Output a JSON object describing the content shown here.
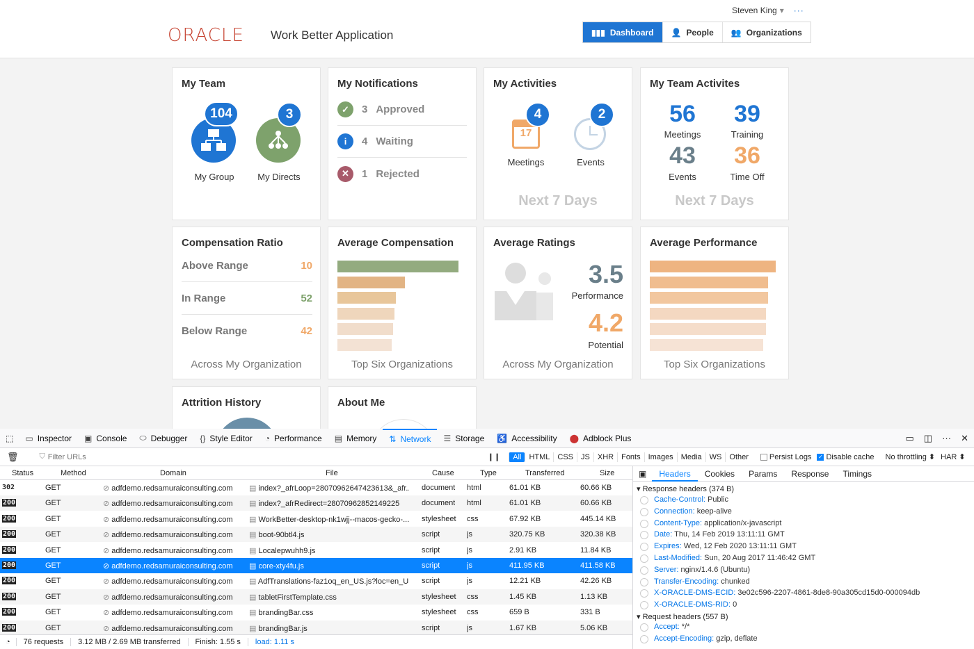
{
  "header": {
    "logo": "ORACLE",
    "app_title": "Work Better Application",
    "user": "Steven King",
    "nav": [
      "Dashboard",
      "People",
      "Organizations"
    ]
  },
  "my_team": {
    "title": "My Team",
    "group_count": "104",
    "group_label": "My Group",
    "directs_count": "3",
    "directs_label": "My Directs"
  },
  "notifications": {
    "title": "My Notifications",
    "items": [
      {
        "count": "3",
        "label": "Approved"
      },
      {
        "count": "4",
        "label": "Waiting"
      },
      {
        "count": "1",
        "label": "Rejected"
      }
    ]
  },
  "activities": {
    "title": "My Activities",
    "meetings_count": "4",
    "meetings_label": "Meetings",
    "calendar_day": "17",
    "events_count": "2",
    "events_label": "Events",
    "footer": "Next 7 Days"
  },
  "team_activities": {
    "title": "My Team Activites",
    "meetings": "56",
    "meetings_label": "Meetings",
    "training": "39",
    "training_label": "Training",
    "events": "43",
    "events_label": "Events",
    "timeoff": "36",
    "timeoff_label": "Time Off",
    "footer": "Next 7 Days"
  },
  "comp_ratio": {
    "title": "Compensation Ratio",
    "rows": [
      {
        "k": "Above Range",
        "v": "10"
      },
      {
        "k": "In Range",
        "v": "52"
      },
      {
        "k": "Below Range",
        "v": "42"
      }
    ],
    "footer": "Across My Organization"
  },
  "avg_comp": {
    "title": "Average Compensation",
    "footer": "Top Six Organizations",
    "bars": [
      1.0,
      0.56,
      0.48,
      0.47,
      0.46,
      0.45
    ]
  },
  "avg_ratings": {
    "title": "Average Ratings",
    "performance": "3.5",
    "performance_label": "Performance",
    "potential": "4.2",
    "potential_label": "Potential",
    "footer": "Across My Organization"
  },
  "avg_perf": {
    "title": "Average Performance",
    "footer": "Top Six Organizations",
    "bars": [
      1.0,
      0.94,
      0.94,
      0.92,
      0.92,
      0.9
    ]
  },
  "attrition": {
    "title": "Attrition History"
  },
  "about": {
    "title": "About Me"
  },
  "devtools": {
    "tabs": [
      "Inspector",
      "Console",
      "Debugger",
      "Style Editor",
      "Performance",
      "Memory",
      "Network",
      "Storage",
      "Accessibility",
      "Adblock Plus"
    ],
    "filter_placeholder": "Filter URLs",
    "types": [
      "All",
      "HTML",
      "CSS",
      "JS",
      "XHR",
      "Fonts",
      "Images",
      "Media",
      "WS",
      "Other"
    ],
    "persist_logs": "Persist Logs",
    "disable_cache": "Disable cache",
    "throttling": "No throttling ⬍",
    "har": "HAR ⬍",
    "columns": [
      "Status",
      "Method",
      "Domain",
      "File",
      "Cause",
      "Type",
      "Transferred",
      "Size"
    ],
    "rows": [
      {
        "status": "302",
        "method": "GET",
        "domain": "adfdemo.redsamuraiconsulting.com",
        "file": "index?_afrLoop=28070962647423613&_afr...",
        "cause": "document",
        "type": "html",
        "transferred": "61.01 KB",
        "size": "60.66 KB"
      },
      {
        "status": "200",
        "method": "GET",
        "domain": "adfdemo.redsamuraiconsulting.com",
        "file": "index?_afrRedirect=28070962852149225",
        "cause": "document",
        "type": "html",
        "transferred": "61.01 KB",
        "size": "60.66 KB"
      },
      {
        "status": "200",
        "method": "GET",
        "domain": "adfdemo.redsamuraiconsulting.com",
        "file": "WorkBetter-desktop-nk1wjj--macos-gecko-...",
        "cause": "stylesheet",
        "type": "css",
        "transferred": "67.92 KB",
        "size": "445.14 KB"
      },
      {
        "status": "200",
        "method": "GET",
        "domain": "adfdemo.redsamuraiconsulting.com",
        "file": "boot-90btl4.js",
        "cause": "script",
        "type": "js",
        "transferred": "320.75 KB",
        "size": "320.38 KB"
      },
      {
        "status": "200",
        "method": "GET",
        "domain": "adfdemo.redsamuraiconsulting.com",
        "file": "Localepwuhh9.js",
        "cause": "script",
        "type": "js",
        "transferred": "2.91 KB",
        "size": "11.84 KB"
      },
      {
        "status": "200",
        "method": "GET",
        "domain": "adfdemo.redsamuraiconsulting.com",
        "file": "core-xty4fu.js",
        "cause": "script",
        "type": "js",
        "transferred": "411.95 KB",
        "size": "411.58 KB"
      },
      {
        "status": "200",
        "method": "GET",
        "domain": "adfdemo.redsamuraiconsulting.com",
        "file": "AdfTranslations-faz1oq_en_US.js?loc=en_US...",
        "cause": "script",
        "type": "js",
        "transferred": "12.21 KB",
        "size": "42.26 KB"
      },
      {
        "status": "200",
        "method": "GET",
        "domain": "adfdemo.redsamuraiconsulting.com",
        "file": "tabletFirstTemplate.css",
        "cause": "stylesheet",
        "type": "css",
        "transferred": "1.45 KB",
        "size": "1.13 KB"
      },
      {
        "status": "200",
        "method": "GET",
        "domain": "adfdemo.redsamuraiconsulting.com",
        "file": "brandingBar.css",
        "cause": "stylesheet",
        "type": "css",
        "transferred": "659 B",
        "size": "331 B"
      },
      {
        "status": "200",
        "method": "GET",
        "domain": "adfdemo.redsamuraiconsulting.com",
        "file": "brandingBar.js",
        "cause": "script",
        "type": "js",
        "transferred": "1.67 KB",
        "size": "5.06 KB"
      }
    ],
    "status_bar": {
      "requests": "76 requests",
      "transferred": "3.12 MB / 2.69 MB transferred",
      "finish": "Finish: 1.55 s",
      "load": "load: 1.11 s"
    },
    "side_tabs": [
      "Headers",
      "Cookies",
      "Params",
      "Response",
      "Timings"
    ],
    "response_headers_title": "Response headers (374 B)",
    "response_headers": [
      {
        "k": "Cache-Control:",
        "v": "Public"
      },
      {
        "k": "Connection:",
        "v": "keep-alive"
      },
      {
        "k": "Content-Type:",
        "v": "application/x-javascript"
      },
      {
        "k": "Date:",
        "v": "Thu, 14 Feb 2019 13:11:11 GMT"
      },
      {
        "k": "Expires:",
        "v": "Wed, 12 Feb 2020 13:11:11 GMT"
      },
      {
        "k": "Last-Modified:",
        "v": "Sun, 20 Aug 2017 11:46:42 GMT"
      },
      {
        "k": "Server:",
        "v": "nginx/1.4.6 (Ubuntu)"
      },
      {
        "k": "Transfer-Encoding:",
        "v": "chunked"
      },
      {
        "k": "X-ORACLE-DMS-ECID:",
        "v": "3e02c596-2207-4861-8de8-90a305cd15d0-000094db"
      },
      {
        "k": "X-ORACLE-DMS-RID:",
        "v": "0"
      }
    ],
    "request_headers_title": "Request headers (557 B)",
    "request_headers": [
      {
        "k": "Accept:",
        "v": "*/*"
      },
      {
        "k": "Accept-Encoding:",
        "v": "gzip, deflate"
      }
    ]
  }
}
